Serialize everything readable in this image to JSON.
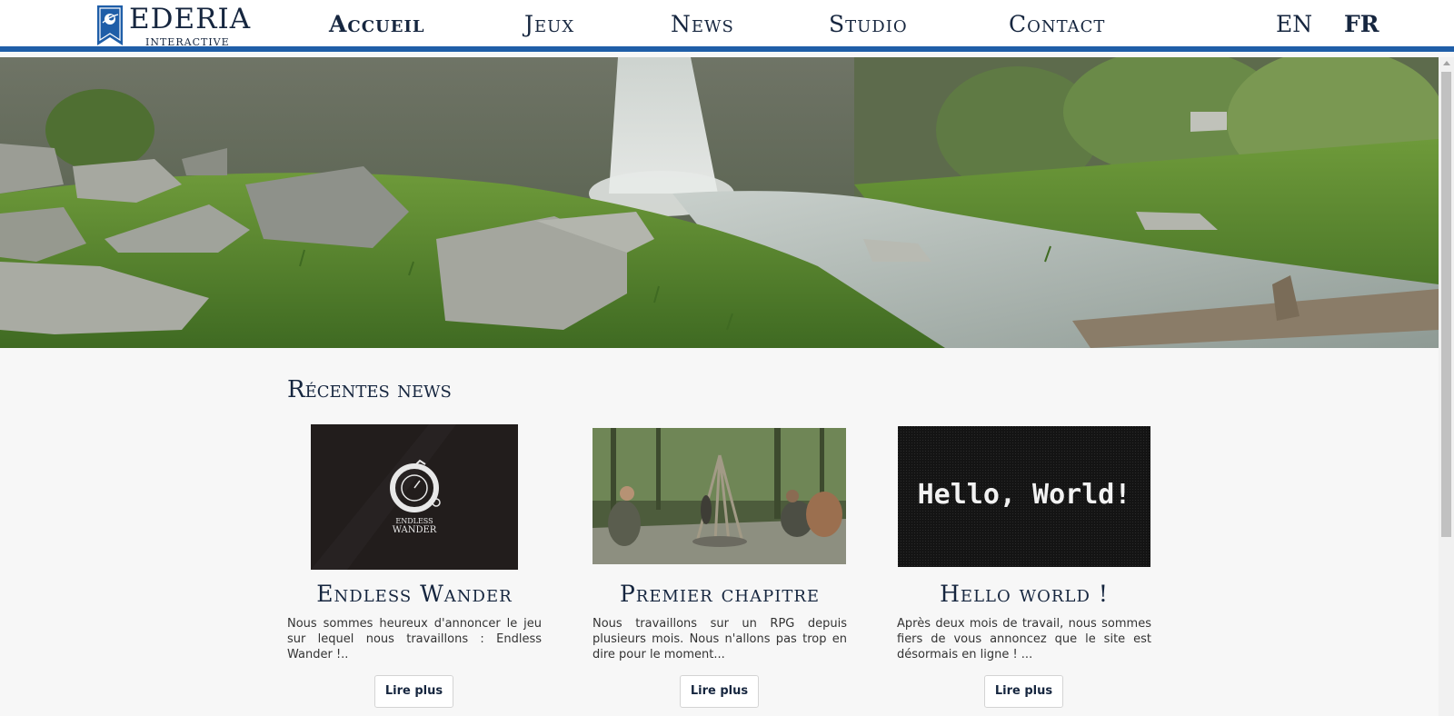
{
  "header": {
    "logo": {
      "name": "EDERIA",
      "subtitle": "Interactive"
    },
    "nav": [
      {
        "label": "Accueil",
        "active": true
      },
      {
        "label": "Jeux",
        "active": false
      },
      {
        "label": "News",
        "active": false
      },
      {
        "label": "Studio",
        "active": false
      },
      {
        "label": "Contact",
        "active": false
      }
    ],
    "languages": [
      {
        "label": "EN",
        "active": false
      },
      {
        "label": "FR",
        "active": true
      }
    ]
  },
  "colors": {
    "brand_blue": "#1f5ea8",
    "text_dark": "#16263f",
    "page_bg": "#f7f7f7"
  },
  "news": {
    "title": "Récentes news",
    "items": [
      {
        "title": "Endless Wander",
        "text": "Nous sommes heureux d'annoncer le jeu sur lequel nous travaillons : Endless Wander !..",
        "button": "Lire plus",
        "image_caption_top": "ENDLESS",
        "image_caption_bottom": "WANDER"
      },
      {
        "title": "Premier chapitre",
        "text": "Nous travaillons sur un RPG depuis plusieurs mois. Nous n'allons pas trop en dire pour le moment...",
        "button": "Lire plus"
      },
      {
        "title": "Hello world !",
        "text": "Après deux mois de travail, nous sommes fiers de vous annoncez que le site est désormais en ligne ! ...",
        "button": "Lire plus",
        "image_text": "Hello, World!"
      }
    ]
  },
  "icons": {
    "logo": "banner-logo-icon",
    "scroll_up": "scroll-up-arrow-icon"
  }
}
